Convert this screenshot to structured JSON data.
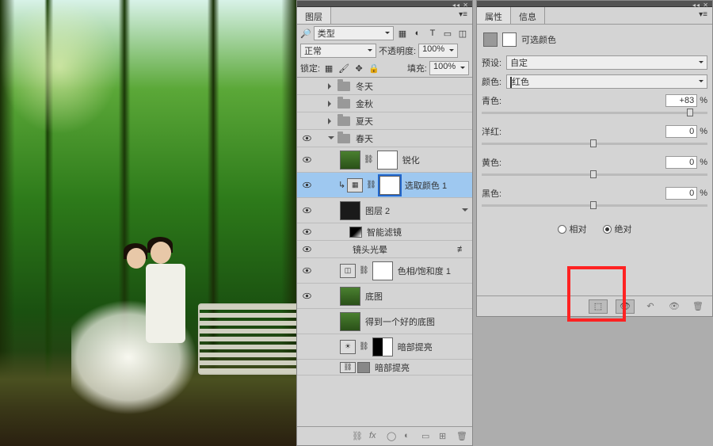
{
  "layersPanel": {
    "tab": "图层",
    "filterLabel": "类型",
    "blendMode": "正常",
    "opacityLabel": "不透明度:",
    "opacityValue": "100%",
    "lockLabel": "锁定:",
    "fillLabel": "填充:",
    "fillValue": "100%",
    "items": {
      "winter": "冬天",
      "autumn": "金秋",
      "summer": "夏天",
      "spring": "春天",
      "sharpen": "锐化",
      "selColor": "选取颜色 1",
      "layer2": "图层 2",
      "smartFilters": "智能滤镜",
      "lensFlare": "镜头光晕",
      "hueSat": "色相/饱和度 1",
      "base": "底图",
      "goodBase": "得到一个好的底图",
      "shadowLift": "暗部提亮",
      "shadowLift2": "暗部提亮"
    }
  },
  "propsPanel": {
    "tabs": {
      "props": "属性",
      "info": "信息"
    },
    "title": "可选颜色",
    "presetLabel": "预设:",
    "presetValue": "自定",
    "colorLabel": "颜色:",
    "colorValue": "红色",
    "sliders": {
      "cyan": {
        "label": "青色:",
        "value": "+83"
      },
      "magenta": {
        "label": "洋红:",
        "value": "0"
      },
      "yellow": {
        "label": "黄色:",
        "value": "0"
      },
      "black": {
        "label": "黑色:",
        "value": "0"
      }
    },
    "relative": "相对",
    "absolute": "绝对"
  },
  "chart_data": null
}
